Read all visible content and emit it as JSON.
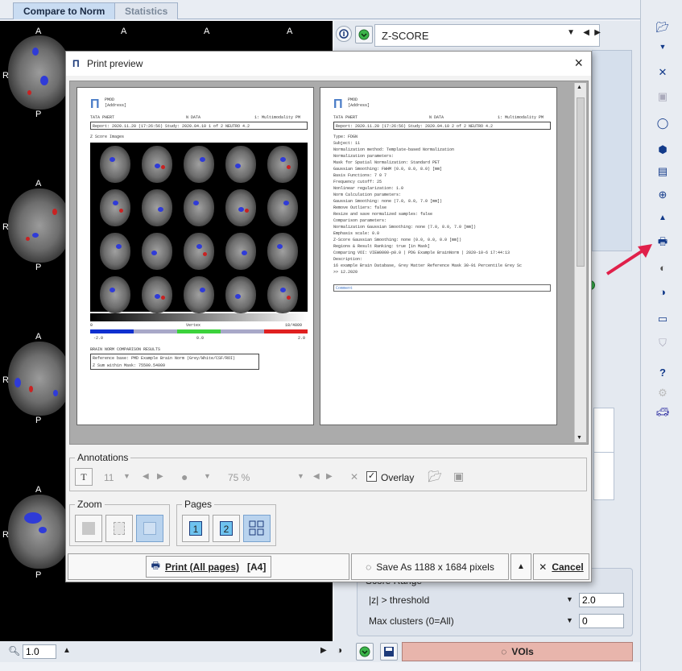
{
  "tabs": {
    "compare": "Compare to Norm",
    "statistics": "Statistics"
  },
  "viewer": {
    "orient_a": "A",
    "orient_p": "P",
    "orient_r": "R"
  },
  "map_select": {
    "value": "Z-SCORE"
  },
  "dialog": {
    "title": "Print preview",
    "close": "×",
    "page1": {
      "logo_lines": [
        "PMOD",
        "[Address]"
      ],
      "header_left": "TATA PHERT",
      "header_mid": "N DATA",
      "header_right": "1: Multimodality PM",
      "report_line": "Report: 2020.11.20 (17:26:56)  Study: 2020.04.10   1 of 2   NEUTRO 4.2",
      "section_title": "Z Score Images",
      "colorbar_min": "-2.0",
      "colorbar_mid": "0.0",
      "colorbar_max": "2.0",
      "scale_left": "0",
      "scale_center": "Vertex",
      "scale_right": "18/4809",
      "results_title": "BRAIN NORM COMPARISON RESULTS",
      "results_row1": "Reference base: PMD Example Brain Norm (Grey/White/CSF/ROI)",
      "results_row2": "Z Sum within Mask: 75500.54009"
    },
    "page2": {
      "logo_lines": [
        "PMOD",
        "[Address]"
      ],
      "header_left": "TATA PHERT",
      "header_mid": "N DATA",
      "header_right": "1: Multimodality PM",
      "report_line": "Report: 2020.11.20 (17:26:56)  Study: 2020.04.10   2 of 2   NEUTRO 4.2",
      "lines": [
        "Type: FDGN",
        "Subject: 11",
        "Normalization method: Template-based Normalization",
        "Normalization parameters:",
        "  Mask for Spatial Normalization: Standard PET",
        "  Gaussian Smoothing: FWHM (0.0, 8.0, 8.0) [mm]",
        "  Basis Functions: 7 0 7",
        "  Frequency cutoff: 25",
        "  Nonlinear regularization: 1.0",
        "Norm Calculation parameters:",
        "  Gaussian Smoothing: none (7.0, 8.0, 7.0 [mm])",
        "  Remove Outliers: false",
        "Resize and save normalized samples: false",
        "Comparison parameters:",
        "  Normalization Gaussian Smoothing: none (7.0, 8.0, 7.0 [mm])",
        "  Emphasis scale: 0.0",
        "  Z-Score Gaussian Smoothing: none (0.0, 0.0, 0.0 [mm])",
        "  Regions & Result Ranking: true [in Mask]",
        "  Comparing VOI: VIEW0000-p0.0 | PDG Example BrainNorm | 2020-10-6 17:44:13",
        "Description:",
        "  16 example Brain Database, Grey Matter Reference Mask 30-91 Percentile Grey Sc",
        ">> 12.2020"
      ],
      "comment_label": "Comment"
    },
    "annotations": {
      "legend": "Annotations",
      "text_tool": "T",
      "font_size": "11",
      "opacity": "75 %",
      "overlay_label": "Overlay",
      "overlay_checked": true
    },
    "zoom": {
      "legend": "Zoom"
    },
    "pages": {
      "legend": "Pages",
      "page1": "1",
      "page2": "2"
    },
    "buttons": {
      "print": "Print (All pages)",
      "print_format": "[A4]",
      "save_as": "Save As 1188 x 1684 pixels",
      "cancel": "Cancel"
    }
  },
  "score_panel": {
    "title": "Score Range",
    "threshold_label": "|z| > threshold",
    "threshold_value": "2.0",
    "max_clusters_label": "Max clusters (0=All)",
    "max_clusters_value": "0"
  },
  "statusbar": {
    "zoom_value": "1.0",
    "vois_label": "VOIs"
  },
  "colors": {
    "accent": "#c9dcf2",
    "voi_button": "#e8b5ac",
    "arrow": "#e0204a"
  }
}
